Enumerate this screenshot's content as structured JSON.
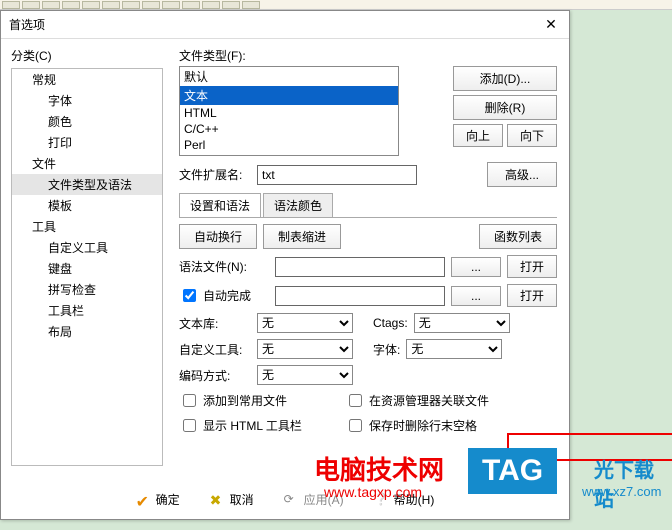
{
  "dialog_title": "首选项",
  "category_label": "分类(C)",
  "tree": [
    {
      "label": "常规",
      "lvl": 1
    },
    {
      "label": "字体",
      "lvl": 2
    },
    {
      "label": "颜色",
      "lvl": 2
    },
    {
      "label": "打印",
      "lvl": 2
    },
    {
      "label": "文件",
      "lvl": 1
    },
    {
      "label": "文件类型及语法",
      "lvl": 2,
      "sel": true
    },
    {
      "label": "模板",
      "lvl": 2
    },
    {
      "label": "工具",
      "lvl": 1
    },
    {
      "label": "自定义工具",
      "lvl": 2
    },
    {
      "label": "键盘",
      "lvl": 2
    },
    {
      "label": "拼写检查",
      "lvl": 2
    },
    {
      "label": "工具栏",
      "lvl": 2
    },
    {
      "label": "布局",
      "lvl": 2
    }
  ],
  "filetype_label": "文件类型(F):",
  "filetypes": [
    {
      "t": "默认"
    },
    {
      "t": "文本",
      "sel": true
    },
    {
      "t": "HTML"
    },
    {
      "t": "C/C++"
    },
    {
      "t": "Perl"
    }
  ],
  "btns": {
    "add": "添加(D)...",
    "del": "删除(R)",
    "up": "向上",
    "down": "向下",
    "adv": "高级...",
    "open": "打开",
    "funclist": "函数列表",
    "autowrap": "自动换行",
    "tabindent": "制表缩进"
  },
  "ext_label": "文件扩展名:",
  "ext_value": "txt",
  "tab_settings": "设置和语法",
  "tab_colors": "语法颜色",
  "syntax_label": "语法文件(N):",
  "syntax_value": "",
  "autocomp_label": "自动完成",
  "autocomp_value": "",
  "textlib_label": "文本库:",
  "textlib_value": "无",
  "ctags_label": "Ctags:",
  "ctags_value": "无",
  "customtool_label": "自定义工具:",
  "customtool_value": "无",
  "font_label": "字体:",
  "font_value": "无",
  "encoding_label": "编码方式:",
  "encoding_value": "无",
  "cb_addcommon": "添加到常用文件",
  "cb_assoc": "在资源管理器关联文件",
  "cb_showhtml": "显示 HTML 工具栏",
  "cb_trimsave": "保存时删除行末空格",
  "footer": {
    "ok": "确定",
    "cancel": "取消",
    "apply": "应用(A)",
    "help": "帮助(H)"
  },
  "wm": {
    "t1": "电脑技术网",
    "u1": "www.tagxp.com",
    "t2": "TAG",
    "t2b": "光下载站",
    "u2": "www.xz7.com"
  }
}
